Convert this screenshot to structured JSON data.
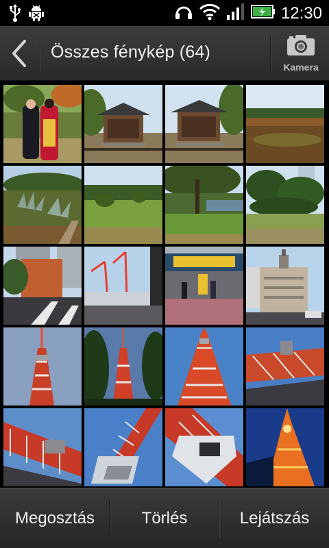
{
  "status_bar": {
    "time": "12:30",
    "icons": [
      "usb-icon",
      "android-debug-icon",
      "headphones-icon",
      "wifi-icon",
      "signal-icon",
      "battery-charging-icon"
    ]
  },
  "header": {
    "title": "Összes fénykép (64)",
    "camera_label": "Kamera"
  },
  "photos": [
    "kimono-couple",
    "temple-1",
    "temple-2",
    "autumn-field",
    "garden-agave",
    "garden-lawn",
    "garden-pond-tree",
    "garden-pines",
    "city-building",
    "cranes",
    "shop-front",
    "wako-building",
    "tower-sky-1",
    "tower-trees",
    "tower-red-up",
    "tower-base-1",
    "tower-base-2",
    "tower-lattice",
    "tower-top-down",
    "tower-night"
  ],
  "bottom_bar": {
    "share_label": "Megosztás",
    "delete_label": "Törlés",
    "play_label": "Lejátszás"
  }
}
